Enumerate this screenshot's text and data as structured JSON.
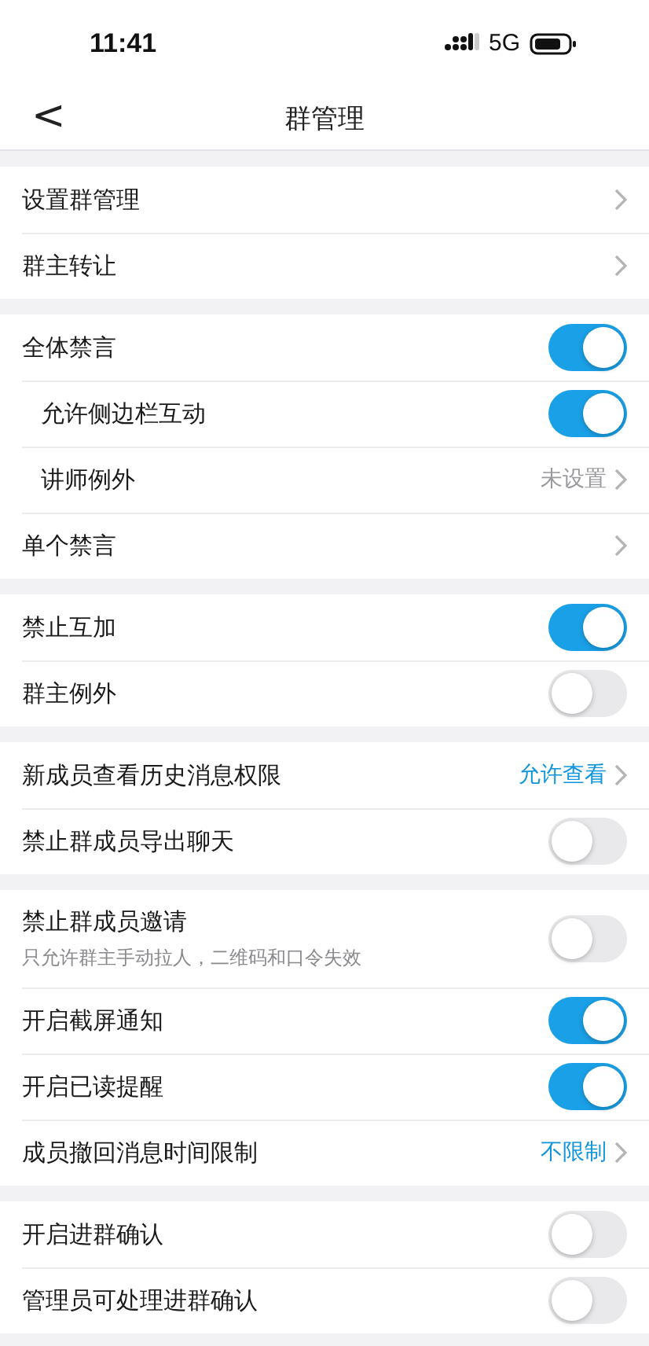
{
  "status_bar": {
    "time": "11:41",
    "network": "5G"
  },
  "nav": {
    "back": "<",
    "title": "群管理"
  },
  "sections": [
    {
      "rows": [
        {
          "kind": "link",
          "label": "设置群管理",
          "indented": false
        },
        {
          "kind": "link",
          "label": "群主转让",
          "indented": false
        }
      ]
    },
    {
      "rows": [
        {
          "kind": "toggle",
          "label": "全体禁言",
          "indented": false,
          "on": true
        },
        {
          "kind": "toggle",
          "label": "允许侧边栏互动",
          "indented": true,
          "on": true
        },
        {
          "kind": "link",
          "label": "讲师例外",
          "indented": true,
          "value": "未设置",
          "accent": false
        },
        {
          "kind": "link",
          "label": "单个禁言",
          "indented": false
        }
      ]
    },
    {
      "rows": [
        {
          "kind": "toggle",
          "label": "禁止互加",
          "indented": false,
          "on": true
        },
        {
          "kind": "toggle",
          "label": "群主例外",
          "indented": false,
          "on": false
        }
      ]
    },
    {
      "rows": [
        {
          "kind": "link",
          "label": "新成员查看历史消息权限",
          "indented": false,
          "value": "允许查看",
          "accent": true
        },
        {
          "kind": "toggle",
          "label": "禁止群成员导出聊天",
          "indented": false,
          "on": false
        }
      ]
    },
    {
      "rows": [
        {
          "kind": "toggle",
          "label": "禁止群成员邀请",
          "indented": false,
          "on": false,
          "hint": "只允许群主手动拉人，二维码和口令失效"
        },
        {
          "kind": "toggle",
          "label": "开启截屏通知",
          "indented": false,
          "on": true
        },
        {
          "kind": "toggle",
          "label": "开启已读提醒",
          "indented": false,
          "on": true
        },
        {
          "kind": "link",
          "label": "成员撤回消息时间限制",
          "indented": false,
          "value": "不限制",
          "accent": true
        }
      ]
    },
    {
      "rows": [
        {
          "kind": "toggle",
          "label": "开启进群确认",
          "indented": false,
          "on": false
        },
        {
          "kind": "toggle",
          "label": "管理员可处理进群确认",
          "indented": false,
          "on": false
        }
      ]
    }
  ]
}
